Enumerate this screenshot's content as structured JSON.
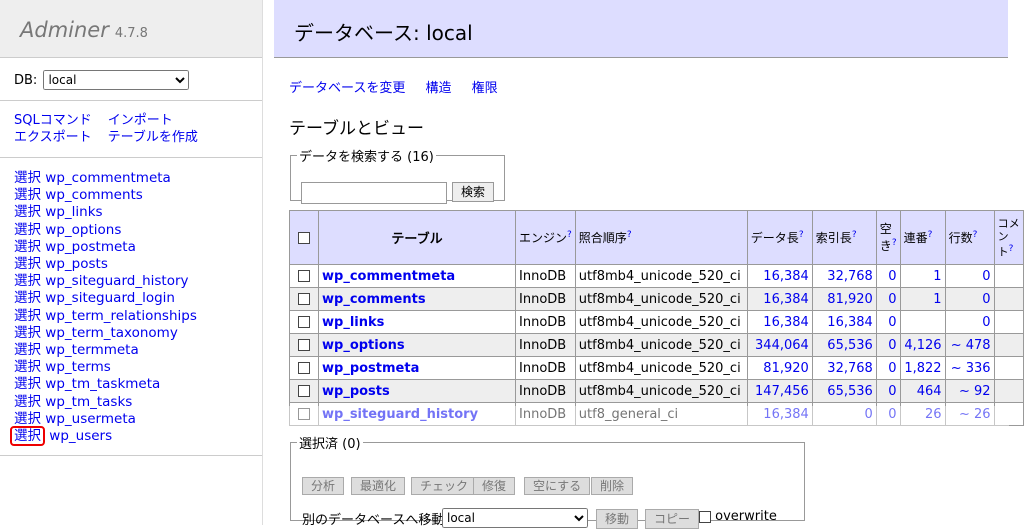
{
  "sidebar": {
    "logo": "Adminer",
    "version": "4.7.8",
    "db_label": "DB:",
    "db_value": "local",
    "links": [
      "SQLコマンド",
      "インポート",
      "エクスポート",
      "テーブルを作成"
    ],
    "select_label": "選択",
    "tables": [
      "wp_commentmeta",
      "wp_comments",
      "wp_links",
      "wp_options",
      "wp_postmeta",
      "wp_posts",
      "wp_siteguard_history",
      "wp_siteguard_login",
      "wp_term_relationships",
      "wp_term_taxonomy",
      "wp_termmeta",
      "wp_terms",
      "wp_tm_taskmeta",
      "wp_tm_tasks",
      "wp_usermeta",
      "wp_users"
    ]
  },
  "header": {
    "title": "データベース: local"
  },
  "nav": [
    "データベースを変更",
    "構造",
    "権限"
  ],
  "subtitle": "テーブルとビュー",
  "search": {
    "legend": "データを検索する (16)",
    "button": "検索"
  },
  "table": {
    "headers": [
      "テーブル",
      "エンジン",
      "照合順序",
      "データ長",
      "索引長",
      "空き",
      "連番",
      "行数",
      "コメント"
    ],
    "help_mark": "?",
    "rows": [
      [
        "wp_commentmeta",
        "InnoDB",
        "utf8mb4_unicode_520_ci",
        "16,384",
        "32,768",
        "0",
        "1",
        "0"
      ],
      [
        "wp_comments",
        "InnoDB",
        "utf8mb4_unicode_520_ci",
        "16,384",
        "81,920",
        "0",
        "1",
        "0"
      ],
      [
        "wp_links",
        "InnoDB",
        "utf8mb4_unicode_520_ci",
        "16,384",
        "16,384",
        "0",
        "",
        "0"
      ],
      [
        "wp_options",
        "InnoDB",
        "utf8mb4_unicode_520_ci",
        "344,064",
        "65,536",
        "0",
        "4,126",
        "~ 478"
      ],
      [
        "wp_postmeta",
        "InnoDB",
        "utf8mb4_unicode_520_ci",
        "81,920",
        "32,768",
        "0",
        "1,822",
        "~ 336"
      ],
      [
        "wp_posts",
        "InnoDB",
        "utf8mb4_unicode_520_ci",
        "147,456",
        "65,536",
        "0",
        "464",
        "~ 92"
      ],
      [
        "wp_siteguard_history",
        "InnoDB",
        "utf8_general_ci",
        "16,384",
        "0",
        "0",
        "26",
        "~ 26"
      ]
    ]
  },
  "selection": {
    "legend": "選択済 (0)",
    "buttons": [
      "分析",
      "最適化",
      "チェック",
      "修復",
      "空にする",
      "削除"
    ],
    "move_label": "別のデータベースへ移動:",
    "move_db": "local",
    "move_button": "移動",
    "copy_button": "コピー",
    "overwrite_label": "overwrite"
  },
  "colors": {
    "header_bg": "#ddf",
    "link": "#0000ee",
    "highlight": "#e00"
  }
}
